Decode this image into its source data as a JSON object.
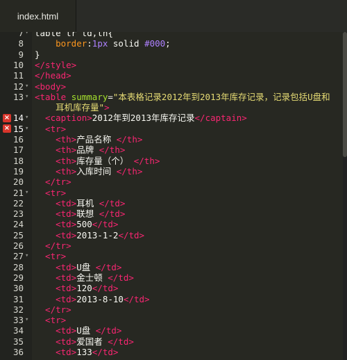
{
  "tab": {
    "title": "index.html"
  },
  "lines": [
    {
      "n": "7",
      "fold": true,
      "err": false,
      "segs": [
        {
          "t": "table tr td,th{",
          "c": ""
        }
      ]
    },
    {
      "n": "8",
      "fold": false,
      "err": false,
      "segs": [
        {
          "t": "    border",
          "c": "css"
        },
        {
          "t": ":",
          "c": ""
        },
        {
          "t": "1px",
          "c": "num2"
        },
        {
          "t": " solid ",
          "c": ""
        },
        {
          "t": "#000",
          "c": "num2"
        },
        {
          "t": ";",
          "c": ""
        }
      ]
    },
    {
      "n": "9",
      "fold": false,
      "err": false,
      "segs": [
        {
          "t": "}",
          "c": ""
        }
      ]
    },
    {
      "n": "10",
      "fold": false,
      "err": false,
      "segs": [
        {
          "t": "</style>",
          "c": "tag"
        }
      ]
    },
    {
      "n": "11",
      "fold": false,
      "err": false,
      "segs": [
        {
          "t": "</head>",
          "c": "tag"
        }
      ]
    },
    {
      "n": "12",
      "fold": true,
      "err": false,
      "segs": [
        {
          "t": "<body>",
          "c": "tag"
        }
      ]
    },
    {
      "n": "13",
      "fold": true,
      "err": false,
      "segs": [
        {
          "t": "<table ",
          "c": "tag"
        },
        {
          "t": "summary",
          "c": "attr"
        },
        {
          "t": "=",
          "c": ""
        },
        {
          "t": "\"本表格记录2012年到2013年库存记录，记录包括U盘和",
          "c": "str"
        }
      ]
    },
    {
      "n": "",
      "fold": false,
      "err": false,
      "segs": [
        {
          "t": "    耳机库存量\"",
          "c": "str"
        },
        {
          "t": ">",
          "c": "tag"
        }
      ]
    },
    {
      "n": "14",
      "fold": true,
      "err": true,
      "segs": [
        {
          "t": "  <caption>",
          "c": "tag"
        },
        {
          "t": "2012年到2013年库存记录",
          "c": ""
        },
        {
          "t": "</captain>",
          "c": "tag"
        }
      ]
    },
    {
      "n": "15",
      "fold": true,
      "err": true,
      "segs": [
        {
          "t": "  <tr>",
          "c": "tag"
        }
      ]
    },
    {
      "n": "16",
      "fold": false,
      "err": false,
      "segs": [
        {
          "t": "    <th>",
          "c": "tag"
        },
        {
          "t": "产品名称 ",
          "c": ""
        },
        {
          "t": "</th>",
          "c": "tag"
        }
      ]
    },
    {
      "n": "17",
      "fold": false,
      "err": false,
      "segs": [
        {
          "t": "    <th>",
          "c": "tag"
        },
        {
          "t": "品牌 ",
          "c": ""
        },
        {
          "t": "</th>",
          "c": "tag"
        }
      ]
    },
    {
      "n": "18",
      "fold": false,
      "err": false,
      "segs": [
        {
          "t": "    <th>",
          "c": "tag"
        },
        {
          "t": "库存量（个） ",
          "c": ""
        },
        {
          "t": "</th>",
          "c": "tag"
        }
      ]
    },
    {
      "n": "19",
      "fold": false,
      "err": false,
      "segs": [
        {
          "t": "    <th>",
          "c": "tag"
        },
        {
          "t": "入库时间 ",
          "c": ""
        },
        {
          "t": "</th>",
          "c": "tag"
        }
      ]
    },
    {
      "n": "20",
      "fold": false,
      "err": false,
      "segs": [
        {
          "t": "  </tr>",
          "c": "tag"
        }
      ]
    },
    {
      "n": "21",
      "fold": true,
      "err": false,
      "segs": [
        {
          "t": "  <tr>",
          "c": "tag"
        }
      ]
    },
    {
      "n": "22",
      "fold": false,
      "err": false,
      "segs": [
        {
          "t": "    <td>",
          "c": "tag"
        },
        {
          "t": "耳机 ",
          "c": ""
        },
        {
          "t": "</td>",
          "c": "tag"
        }
      ]
    },
    {
      "n": "23",
      "fold": false,
      "err": false,
      "segs": [
        {
          "t": "    <td>",
          "c": "tag"
        },
        {
          "t": "联想 ",
          "c": ""
        },
        {
          "t": "</td>",
          "c": "tag"
        }
      ]
    },
    {
      "n": "24",
      "fold": false,
      "err": false,
      "segs": [
        {
          "t": "    <td>",
          "c": "tag"
        },
        {
          "t": "500",
          "c": ""
        },
        {
          "t": "</td>",
          "c": "tag"
        }
      ]
    },
    {
      "n": "25",
      "fold": false,
      "err": false,
      "segs": [
        {
          "t": "    <td>",
          "c": "tag"
        },
        {
          "t": "2013-1-2",
          "c": ""
        },
        {
          "t": "</td>",
          "c": "tag"
        }
      ]
    },
    {
      "n": "26",
      "fold": false,
      "err": false,
      "segs": [
        {
          "t": "  </tr>",
          "c": "tag"
        }
      ]
    },
    {
      "n": "27",
      "fold": true,
      "err": false,
      "segs": [
        {
          "t": "  <tr>",
          "c": "tag"
        }
      ]
    },
    {
      "n": "28",
      "fold": false,
      "err": false,
      "segs": [
        {
          "t": "    <td>",
          "c": "tag"
        },
        {
          "t": "U盘 ",
          "c": ""
        },
        {
          "t": "</td>",
          "c": "tag"
        }
      ]
    },
    {
      "n": "29",
      "fold": false,
      "err": false,
      "segs": [
        {
          "t": "    <td>",
          "c": "tag"
        },
        {
          "t": "金士顿 ",
          "c": ""
        },
        {
          "t": "</td>",
          "c": "tag"
        }
      ]
    },
    {
      "n": "30",
      "fold": false,
      "err": false,
      "segs": [
        {
          "t": "    <td>",
          "c": "tag"
        },
        {
          "t": "120",
          "c": ""
        },
        {
          "t": "</td>",
          "c": "tag"
        }
      ]
    },
    {
      "n": "31",
      "fold": false,
      "err": false,
      "segs": [
        {
          "t": "    <td>",
          "c": "tag"
        },
        {
          "t": "2013-8-10",
          "c": ""
        },
        {
          "t": "</td>",
          "c": "tag"
        }
      ]
    },
    {
      "n": "32",
      "fold": false,
      "err": false,
      "segs": [
        {
          "t": "  </tr>",
          "c": "tag"
        }
      ]
    },
    {
      "n": "33",
      "fold": true,
      "err": false,
      "segs": [
        {
          "t": "  <tr>",
          "c": "tag"
        }
      ]
    },
    {
      "n": "34",
      "fold": false,
      "err": false,
      "segs": [
        {
          "t": "    <td>",
          "c": "tag"
        },
        {
          "t": "U盘 ",
          "c": ""
        },
        {
          "t": "</td>",
          "c": "tag"
        }
      ]
    },
    {
      "n": "35",
      "fold": false,
      "err": false,
      "segs": [
        {
          "t": "    <td>",
          "c": "tag"
        },
        {
          "t": "爱国者 ",
          "c": ""
        },
        {
          "t": "</td>",
          "c": "tag"
        }
      ]
    },
    {
      "n": "36",
      "fold": false,
      "err": false,
      "segs": [
        {
          "t": "    <td>",
          "c": "tag"
        },
        {
          "t": "133",
          "c": ""
        },
        {
          "t": "</td>",
          "c": "tag"
        }
      ]
    }
  ]
}
